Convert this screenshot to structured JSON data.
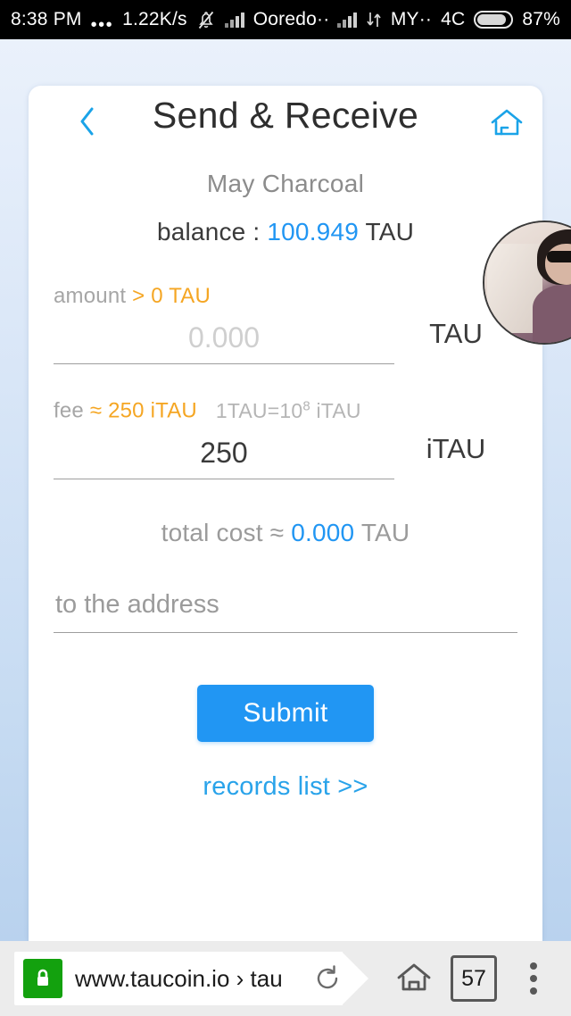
{
  "status_bar": {
    "time": "8:38 PM",
    "overflow_dots": "•••",
    "network_speed": "1.22K/s",
    "mute_icon": "bell-muted-icon",
    "signal_icon_1": "signal-bars-icon",
    "carrier": "Ooredo··",
    "signal_icon_2": "signal-bars-icon",
    "data_icon": "data-transfer-icon",
    "carrier_2": "MY··",
    "network_type": "4C",
    "battery_icon": "battery-icon",
    "battery_percent": "87%"
  },
  "header": {
    "back_icon": "chevron-left-icon",
    "title": "Send & Receive",
    "home_icon": "home-icon",
    "avatar": "user-avatar"
  },
  "account": {
    "username": "May Charcoal",
    "balance_label": "balance :",
    "balance_value": "100.949",
    "balance_unit": "TAU"
  },
  "amount_field": {
    "label": "amount",
    "constraint": "> 0 TAU",
    "placeholder": "0.000",
    "value": "",
    "unit": "TAU"
  },
  "fee_field": {
    "label": "fee",
    "approx": "≈ 250 iTAU",
    "note_prefix": "1TAU=10",
    "note_sup": "8",
    "note_suffix": " iTAU",
    "value": "250",
    "placeholder": "250",
    "unit": "iTAU"
  },
  "total": {
    "label": "total cost ≈",
    "value": "0.000",
    "unit": "TAU"
  },
  "address_field": {
    "placeholder": "to the address",
    "value": ""
  },
  "actions": {
    "submit_label": "Submit",
    "records_label": "records list >>"
  },
  "browser": {
    "lock_icon": "lock-icon",
    "url": "www.taucoin.io › tau",
    "reload_icon": "reload-icon",
    "home_icon": "home-icon",
    "tab_count": "57",
    "menu_icon": "kebab-menu-icon"
  },
  "colors": {
    "accent_blue": "#2196f3",
    "link_blue": "#29a3ea",
    "warning_orange": "#f5a623",
    "lock_green": "#13a10e",
    "status_bg": "#000000"
  }
}
